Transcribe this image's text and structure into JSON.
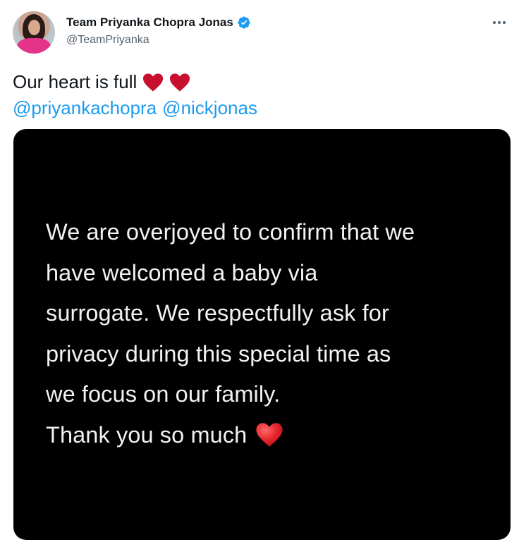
{
  "author": {
    "display_name": "Team Priyanka Chopra Jonas",
    "handle": "@TeamPriyanka",
    "verified": true
  },
  "tweet": {
    "text_line1": "Our heart is full",
    "emojis": [
      "red-heart",
      "red-heart"
    ],
    "mentions": [
      "@priyankachopra",
      "@nickjonas"
    ]
  },
  "media": {
    "lines": [
      "We are overjoyed to confirm that we",
      "have welcomed a baby via",
      "surrogate. We respectfully ask for",
      "privacy during this special time as",
      "we focus on our family.",
      "Thank you so much"
    ],
    "trailing_emoji": "red-heart"
  },
  "colors": {
    "link": "#1d9bf0",
    "verified_badge": "#1d9bf0",
    "heart": "#d1132a",
    "media_bg": "#000000"
  }
}
